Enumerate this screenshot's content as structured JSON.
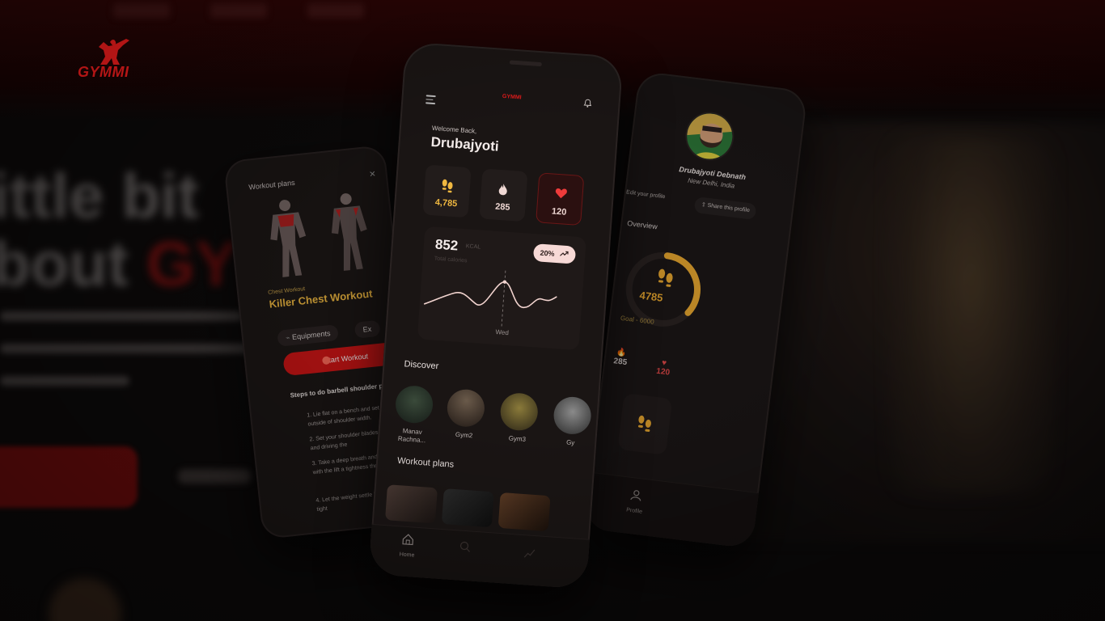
{
  "brand": {
    "logo_text": "GYMMI",
    "accent": "#e31b1b"
  },
  "left_phone": {
    "title": "Workout plans",
    "close_icon": "close-icon",
    "category": "Chest Workout",
    "heading": "Killer Chest Workout",
    "chip_equipment": "Equipments",
    "chip_exercises": "Ex",
    "start_button": "Start Workout",
    "steps_title": "Steps to do barbell shoulder p",
    "steps": [
      "1.  Lie flat on a bench and set a outside of shoulder width.",
      "2.  Set your shoulder blades together and driving the",
      "3.  Take a deep breath and help you with the lift a tightness through you",
      "4.  Let the weight settle back remains tight"
    ]
  },
  "center_phone": {
    "welcome": "Welcome Back,",
    "user_name": "Drubajyoti",
    "stats": [
      {
        "icon": "footsteps-icon",
        "value": "4,785",
        "color": "#f0b840"
      },
      {
        "icon": "flame-icon",
        "value": "285",
        "color": "#f0d8d4"
      },
      {
        "icon": "heart-icon",
        "value": "120",
        "color": "#f0d8d4"
      }
    ],
    "calories": {
      "value": "852",
      "unit": "KCAL",
      "label": "Total calories",
      "change": "20%",
      "day": "Wed"
    },
    "discover_title": "Discover",
    "discover": [
      {
        "label": "Manav Rachna..."
      },
      {
        "label": "Gym2"
      },
      {
        "label": "Gym3"
      },
      {
        "label": "Gy"
      }
    ],
    "workout_title": "Workout plans",
    "nav": {
      "home_label": "Home"
    }
  },
  "right_phone": {
    "name": "Drubajyoti Debnath",
    "location": "New Delhi, India",
    "edit_profile": "Edit your profile",
    "share_profile": "Share this profile",
    "overview_title": "Overview",
    "steps": "4785",
    "goal": "Goal - 6000",
    "calories": "285",
    "heart": "120",
    "nav": {
      "profile_label": "Profile"
    },
    "ring_color": "#e8a830"
  }
}
